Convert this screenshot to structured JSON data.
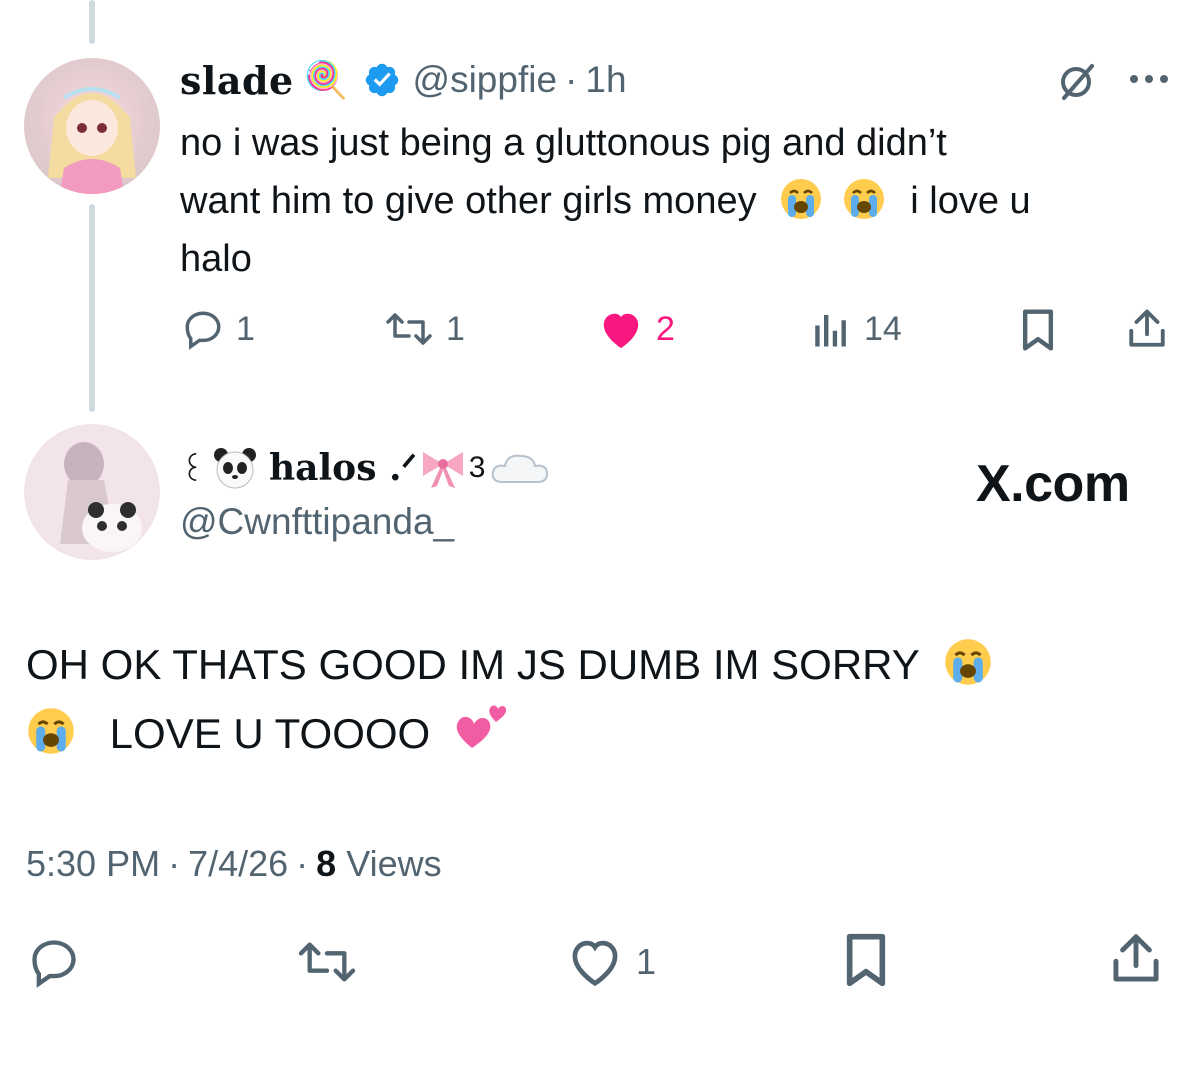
{
  "reply": {
    "display_name": "slade",
    "name_emoji": "🍭",
    "handle": "@sippfie",
    "separator": "·",
    "time_ago": "1h",
    "text_line1": "no i was just being a gluttonous pig and didn’t",
    "text_line2_before": "want him to give other girls money",
    "text_line2_after": "i love u",
    "text_line3": "halo",
    "actions": {
      "replies": "1",
      "reposts": "1",
      "likes": "2",
      "views": "14"
    }
  },
  "main": {
    "display_name_prefix": "꒰",
    "display_name_text": "halos .ᐟ",
    "display_name_suffix": "3",
    "handle": "@Cwnfttipanda_",
    "watermark": "X.com",
    "text_line1": "OH OK THATS GOOD IM JS DUMB IM SORRY",
    "text_line2": "LOVE U TOOOO",
    "meta": {
      "time": "5:30 PM",
      "sep1": "·",
      "date": "7/4/26",
      "sep2": "·",
      "views_count": "8",
      "views_label": "Views"
    },
    "actions": {
      "likes": "1"
    }
  },
  "colors": {
    "text": "#0f1419",
    "muted": "#536471",
    "verified": "#1d9bf0",
    "like": "#f91880",
    "thread_line": "#cfd9de"
  }
}
